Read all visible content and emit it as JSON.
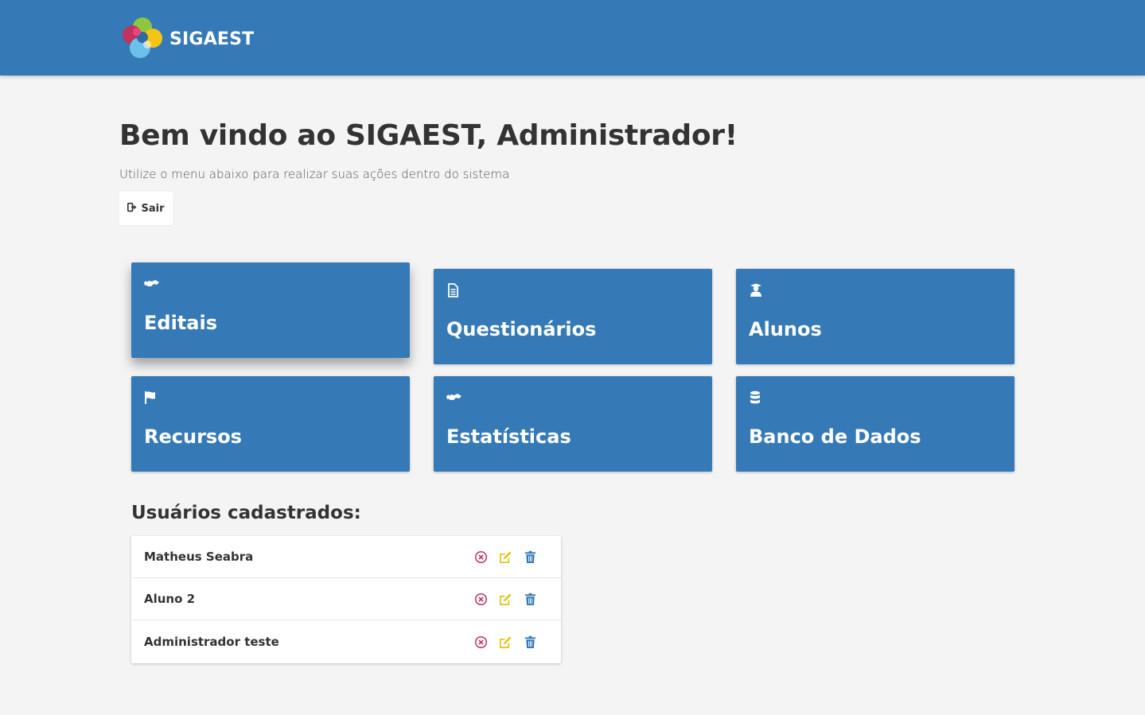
{
  "header": {
    "brand": "SIGAEST"
  },
  "welcome": {
    "title": "Bem vindo ao SIGAEST, Administrador!",
    "subtitle": "Utilize o menu abaixo para realizar suas ações dentro do sistema",
    "logout_label": "Sair"
  },
  "menu": [
    {
      "label": "Editais",
      "icon": "handshake-icon"
    },
    {
      "label": "Questionários",
      "icon": "file-text-icon"
    },
    {
      "label": "Alunos",
      "icon": "graduate-icon"
    },
    {
      "label": "Recursos",
      "icon": "flag-icon"
    },
    {
      "label": "Estatísticas",
      "icon": "handshake-icon"
    },
    {
      "label": "Banco de Dados",
      "icon": "database-icon"
    }
  ],
  "users": {
    "title": "Usuários cadastrados:",
    "items": [
      {
        "name": "Matheus Seabra"
      },
      {
        "name": "Aluno 2"
      },
      {
        "name": "Administrador teste"
      }
    ]
  },
  "colors": {
    "primary": "#357ab7",
    "background": "#f4f4f4",
    "block": "#c0335e",
    "edit": "#e3c31c",
    "delete": "#357ab7"
  }
}
